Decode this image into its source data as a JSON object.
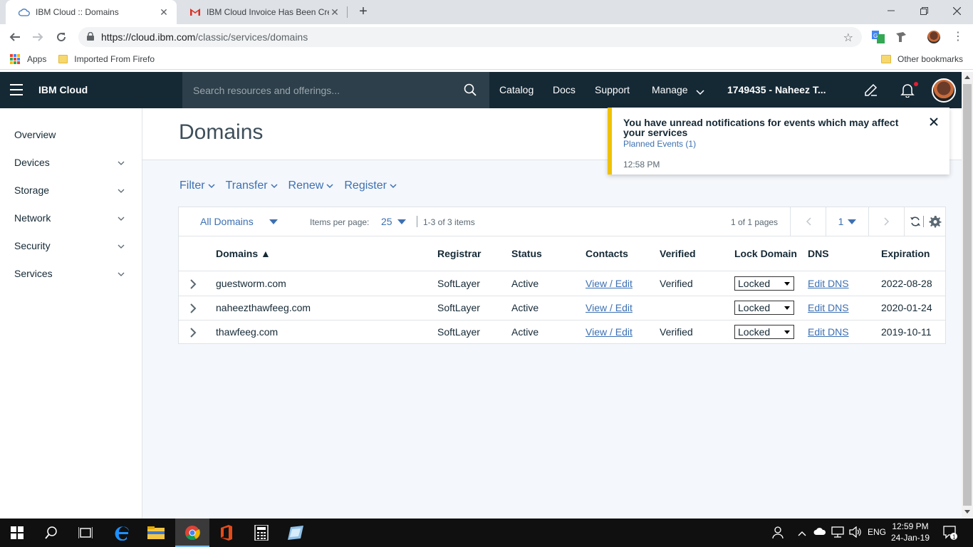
{
  "browser": {
    "tabs": [
      {
        "title": "IBM Cloud :: Domains",
        "active": true
      },
      {
        "title": "IBM Cloud Invoice Has Been Crea",
        "active": false
      }
    ],
    "url_host": "https://cloud.ibm.com",
    "url_path": "/classic/services/domains",
    "bookmarks": {
      "apps": "Apps",
      "imported": "Imported From Firefo",
      "other": "Other bookmarks"
    }
  },
  "header": {
    "brand": "IBM Cloud",
    "search_placeholder": "Search resources and offerings...",
    "nav": [
      "Catalog",
      "Docs",
      "Support",
      "Manage"
    ],
    "account": "1749435 - Naheez T..."
  },
  "sidebar": {
    "items": [
      {
        "label": "Overview",
        "expandable": false
      },
      {
        "label": "Devices",
        "expandable": true
      },
      {
        "label": "Storage",
        "expandable": true
      },
      {
        "label": "Network",
        "expandable": true
      },
      {
        "label": "Security",
        "expandable": true
      },
      {
        "label": "Services",
        "expandable": true
      }
    ]
  },
  "page": {
    "title": "Domains",
    "actions": [
      "Filter",
      "Transfer",
      "Renew",
      "Register"
    ]
  },
  "table": {
    "filter": "All Domains",
    "items_per_page_label": "Items per page:",
    "items_per_page": "25",
    "item_count": "1-3 of 3 items",
    "pages": "1 of 1 pages",
    "current_page": "1",
    "columns": [
      "Domains ▲",
      "Registrar",
      "Status",
      "Contacts",
      "Verified",
      "Lock Domain",
      "DNS",
      "Expiration"
    ],
    "rows": [
      {
        "domain": "guestworm.com",
        "registrar": "SoftLayer",
        "status": "Active",
        "contacts": "View / Edit",
        "verified": "Verified",
        "lock": "Locked",
        "dns": "Edit DNS",
        "expiration": "2022-08-28"
      },
      {
        "domain": "naheezthawfeeg.com",
        "registrar": "SoftLayer",
        "status": "Active",
        "contacts": "View / Edit",
        "verified": "",
        "lock": "Locked",
        "dns": "Edit DNS",
        "expiration": "2020-01-24"
      },
      {
        "domain": "thawfeeg.com",
        "registrar": "SoftLayer",
        "status": "Active",
        "contacts": "View / Edit",
        "verified": "Verified",
        "lock": "Locked",
        "dns": "Edit DNS",
        "expiration": "2019-10-11"
      }
    ]
  },
  "notification": {
    "title": "You have unread notifications for events which may affect your services",
    "link": "Planned Events (1)",
    "time": "12:58 PM"
  },
  "taskbar": {
    "lang": "ENG",
    "time": "12:59 PM",
    "date": "24-Jan-19",
    "notification_count": "1"
  },
  "colors": {
    "header_bg": "#152935",
    "link": "#3d70b2",
    "toast_accent": "#efc100",
    "main_bg": "#f4f7fb"
  }
}
